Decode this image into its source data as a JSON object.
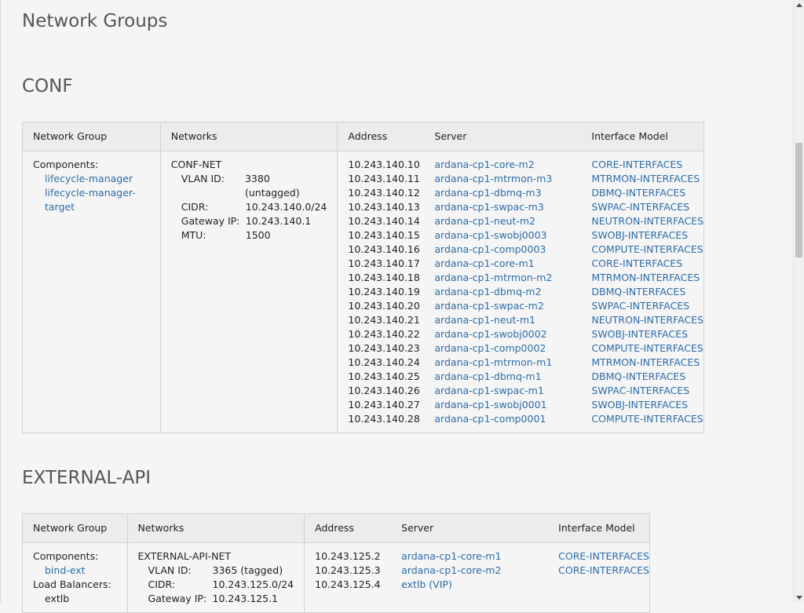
{
  "page": {
    "title": "Network Groups"
  },
  "conf": {
    "title": "CONF",
    "headers": {
      "network_group": "Network Group",
      "networks": "Networks",
      "address": "Address",
      "server": "Server",
      "interface_model": "Interface Model"
    },
    "components_label": "Components:",
    "components": [
      "lifecycle-manager",
      "lifecycle-manager-target"
    ],
    "network": {
      "name": "CONF-NET",
      "vlan_label": "VLAN ID:",
      "vlan_value": "3380 (untagged)",
      "cidr_label": "CIDR:",
      "cidr_value": "10.243.140.0/24",
      "gateway_label": "Gateway IP:",
      "gateway_value": "10.243.140.1",
      "mtu_label": "MTU:",
      "mtu_value": "1500"
    },
    "rows": [
      {
        "address": "10.243.140.10",
        "server": "ardana-cp1-core-m2",
        "model": "CORE-INTERFACES"
      },
      {
        "address": "10.243.140.11",
        "server": "ardana-cp1-mtrmon-m3",
        "model": "MTRMON-INTERFACES"
      },
      {
        "address": "10.243.140.12",
        "server": "ardana-cp1-dbmq-m3",
        "model": "DBMQ-INTERFACES"
      },
      {
        "address": "10.243.140.13",
        "server": "ardana-cp1-swpac-m3",
        "model": "SWPAC-INTERFACES"
      },
      {
        "address": "10.243.140.14",
        "server": "ardana-cp1-neut-m2",
        "model": "NEUTRON-INTERFACES"
      },
      {
        "address": "10.243.140.15",
        "server": "ardana-cp1-swobj0003",
        "model": "SWOBJ-INTERFACES"
      },
      {
        "address": "10.243.140.16",
        "server": "ardana-cp1-comp0003",
        "model": "COMPUTE-INTERFACES"
      },
      {
        "address": "10.243.140.17",
        "server": "ardana-cp1-core-m1",
        "model": "CORE-INTERFACES"
      },
      {
        "address": "10.243.140.18",
        "server": "ardana-cp1-mtrmon-m2",
        "model": "MTRMON-INTERFACES"
      },
      {
        "address": "10.243.140.19",
        "server": "ardana-cp1-dbmq-m2",
        "model": "DBMQ-INTERFACES"
      },
      {
        "address": "10.243.140.20",
        "server": "ardana-cp1-swpac-m2",
        "model": "SWPAC-INTERFACES"
      },
      {
        "address": "10.243.140.21",
        "server": "ardana-cp1-neut-m1",
        "model": "NEUTRON-INTERFACES"
      },
      {
        "address": "10.243.140.22",
        "server": "ardana-cp1-swobj0002",
        "model": "SWOBJ-INTERFACES"
      },
      {
        "address": "10.243.140.23",
        "server": "ardana-cp1-comp0002",
        "model": "COMPUTE-INTERFACES"
      },
      {
        "address": "10.243.140.24",
        "server": "ardana-cp1-mtrmon-m1",
        "model": "MTRMON-INTERFACES"
      },
      {
        "address": "10.243.140.25",
        "server": "ardana-cp1-dbmq-m1",
        "model": "DBMQ-INTERFACES"
      },
      {
        "address": "10.243.140.26",
        "server": "ardana-cp1-swpac-m1",
        "model": "SWPAC-INTERFACES"
      },
      {
        "address": "10.243.140.27",
        "server": "ardana-cp1-swobj0001",
        "model": "SWOBJ-INTERFACES"
      },
      {
        "address": "10.243.140.28",
        "server": "ardana-cp1-comp0001",
        "model": "COMPUTE-INTERFACES"
      }
    ]
  },
  "external_api": {
    "title": "EXTERNAL-API",
    "headers": {
      "network_group": "Network Group",
      "networks": "Networks",
      "address": "Address",
      "server": "Server",
      "interface_model": "Interface Model"
    },
    "components_label": "Components:",
    "components": [
      "bind-ext"
    ],
    "load_balancers_label": "Load Balancers:",
    "load_balancers": [
      "extlb"
    ],
    "network": {
      "name": "EXTERNAL-API-NET",
      "vlan_label": "VLAN ID:",
      "vlan_value": "3365 (tagged)",
      "cidr_label": "CIDR:",
      "cidr_value": "10.243.125.0/24",
      "gateway_label": "Gateway IP:",
      "gateway_value": "10.243.125.1"
    },
    "rows": [
      {
        "address": "10.243.125.2",
        "server": "ardana-cp1-core-m1",
        "model": "CORE-INTERFACES"
      },
      {
        "address": "10.243.125.3",
        "server": "ardana-cp1-core-m2",
        "model": "CORE-INTERFACES"
      },
      {
        "address": "10.243.125.4",
        "server": "extlb (VIP)",
        "model": ""
      }
    ]
  }
}
